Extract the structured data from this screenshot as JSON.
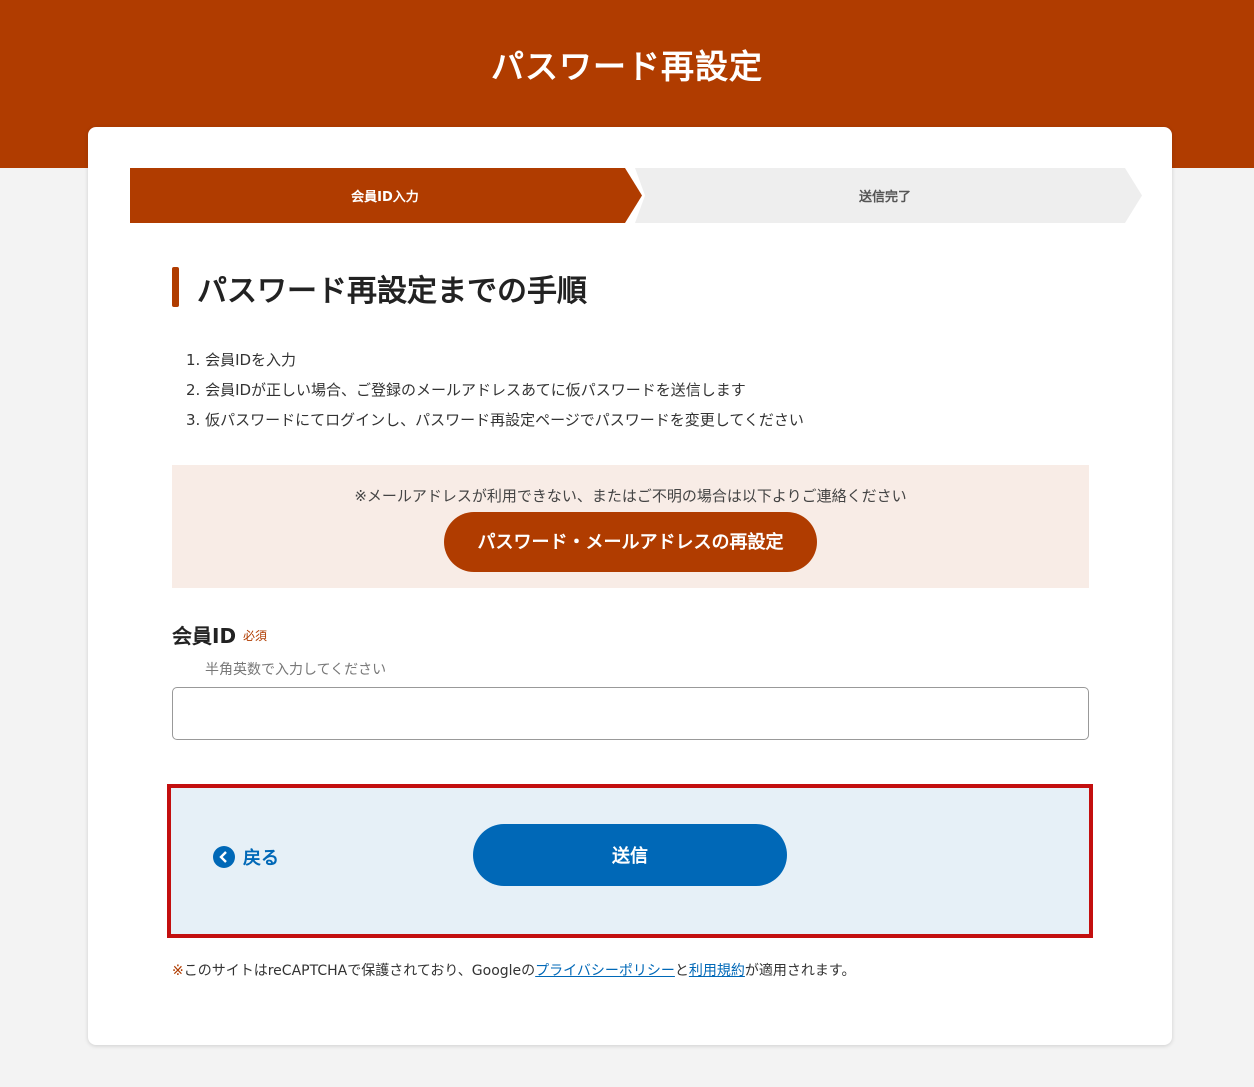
{
  "header": {
    "title": "パスワード再設定"
  },
  "steps": [
    {
      "label": "会員ID入力",
      "active": true
    },
    {
      "label": "送信完了",
      "active": false
    }
  ],
  "colors": {
    "brand": "#b03c00",
    "accent_blue": "#0068b7",
    "highlight_border": "#c30f0f"
  },
  "section": {
    "title": "パスワード再設定までの手順",
    "items": [
      "1. 会員IDを入力",
      "2. 会員IDが正しい場合、ご登録のメールアドレスあてに仮パスワードを送信します",
      "3. 仮パスワードにてログインし、パスワード再設定ページでパスワードを変更してください"
    ]
  },
  "notice": {
    "text": "※メールアドレスが利用できない、またはご不明の場合は以下よりご連絡ください",
    "button_label": "パスワード・メールアドレスの再設定"
  },
  "member_id": {
    "label": "会員ID",
    "required": "必須",
    "hint": "半角英数で入力してください",
    "value": ""
  },
  "actions": {
    "back_label": "戻る",
    "back_icon": "chevron-left-icon",
    "submit_label": "送信"
  },
  "recaptcha": {
    "mark": "※",
    "prefix": "このサイトはreCAPTCHAで保護されており、Googleの",
    "privacy_link": "プライバシーポリシー",
    "and": "と",
    "terms_link": "利用規約",
    "suffix": "が適用されます。"
  }
}
